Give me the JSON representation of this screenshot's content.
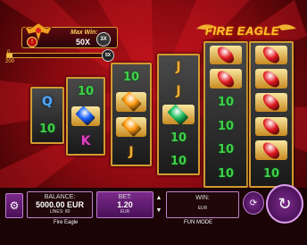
{
  "header": {
    "max_win_label": "Max Win:",
    "max_win_value": "50X",
    "pin_label": "!",
    "bet_level": "3X",
    "progress_min": "0",
    "progress_max": "200",
    "progress_fraction": 0.05,
    "multiplier_badge": "5X",
    "logo_text": "FIRE EAGLE"
  },
  "reels": [
    {
      "top": "Q",
      "cells": [
        "Q",
        "10"
      ]
    },
    {
      "cells": [
        "10",
        "blue-gem",
        "K"
      ]
    },
    {
      "cells": [
        "10",
        "orange-gem",
        "orange-gem",
        "J"
      ]
    },
    {
      "cells": [
        "J",
        "J",
        "green-gem",
        "10",
        "10"
      ]
    },
    {
      "cells": [
        "red-gem",
        "red-gem",
        "10",
        "10",
        "10",
        "10"
      ]
    },
    {
      "cells": [
        "red-gem",
        "red-gem",
        "red-gem",
        "red-gem",
        "red-gem",
        "10"
      ]
    }
  ],
  "symbols": {
    "ten": "10",
    "jack": "J",
    "queen": "Q",
    "king": "K"
  },
  "footer": {
    "balance_label": "BALANCE:",
    "balance_value": "5000.00",
    "balance_currency": "EUR",
    "lines_label": "LINES: 80",
    "bet_label": "BET:",
    "bet_value": "1.20",
    "bet_currency": "EUR",
    "bet_up": "▲",
    "bet_down": "▼",
    "win_label": "WIN:",
    "win_currency": "EUR",
    "game_name": "Fire Eagle",
    "mode": "FUN MODE"
  },
  "colors": {
    "gold": "#d49a30",
    "purple": "#7a2a8a",
    "red_bg": "#c0121c"
  }
}
